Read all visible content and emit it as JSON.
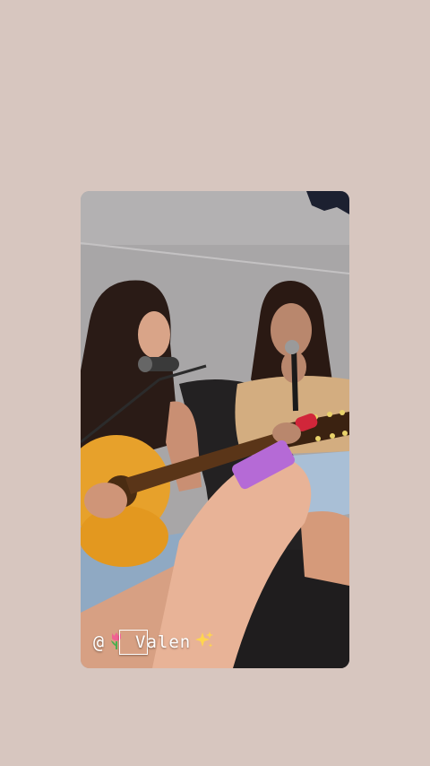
{
  "story": {
    "mention": {
      "at_symbol": "@",
      "username": "Valen",
      "leading_emoji": "tulip-icon",
      "trailing_emoji": "sparkles-icon"
    }
  },
  "colors": {
    "background": "#d7c6bf",
    "guitar": "#e7a12b",
    "phone": "#b56ad6",
    "wall": "#a9a7a8",
    "sofa": "#1f1d1e"
  }
}
